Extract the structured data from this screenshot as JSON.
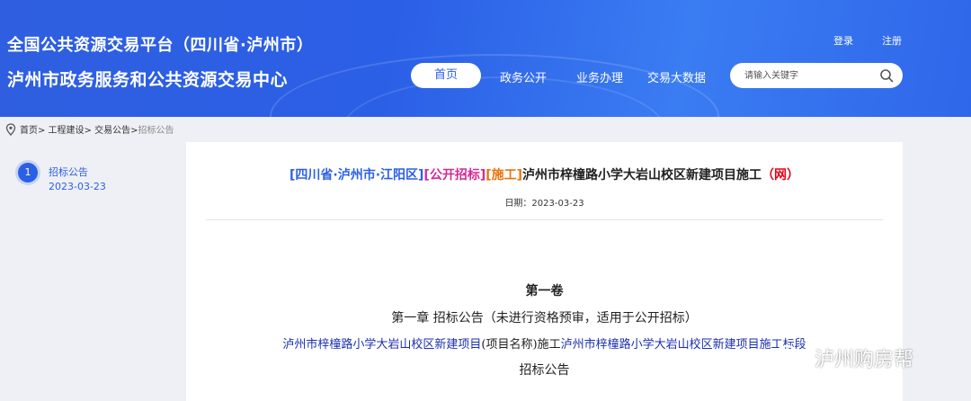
{
  "header": {
    "title_line1": "全国公共资源交易平台（四川省·泸州市）",
    "title_line2": "泸州市政务服务和公共资源交易中心",
    "login": "登录",
    "register": "注册",
    "nav": [
      "首页",
      "政务公开",
      "业务办理",
      "交易大数据"
    ],
    "search_placeholder": "请输入关键字"
  },
  "breadcrumb": {
    "path": "首页> 工程建设> 交易公告> ",
    "current": "招标公告"
  },
  "timeline": {
    "index": "1",
    "label": "招标公告",
    "date": "2023-03-23"
  },
  "article": {
    "title_region": "[四川省·泸州市·江阳区]",
    "title_type": "[公开招标]",
    "title_category": "[施工]",
    "title_main": "泸州市梓橦路小学大岩山校区新建项目施工",
    "title_suffix": "（网）",
    "date": "日期：2023-03-23",
    "volume": "第一卷",
    "chapter": "第一章  招标公告（未进行资格预审，适用于公开招标）",
    "project_name": "泸州市梓橦路小学大岩山校区新建项目",
    "project_mid": "(项目名称)施工",
    "project_section": "泸州市梓橦路小学大岩山校区新建项目施工标段",
    "notice": "招标公告"
  },
  "watermark": "泸州购房帮",
  "colors": {
    "brand_blue": "#2b5fe6",
    "pink": "#d42a95",
    "orange": "#e8740c",
    "red": "#e60012"
  }
}
